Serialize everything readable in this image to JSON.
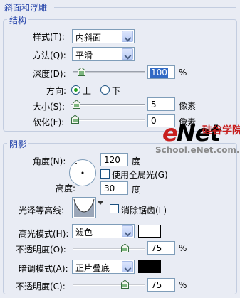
{
  "panel_title": "斜面和浮雕",
  "structure": {
    "title": "结构",
    "style_label": "样式(T):",
    "style_value": "内斜面",
    "technique_label": "方法(Q):",
    "technique_value": "平滑",
    "depth_label": "深度(D):",
    "depth_value": "100",
    "depth_unit": "%",
    "depth_slider_pct": 0.07,
    "direction_label": "方向:",
    "direction_up": "上",
    "direction_down": "下",
    "direction_selected": "up",
    "size_label": "大小(S):",
    "size_value": "5",
    "size_unit": "像素",
    "size_slider_pct": 0.02,
    "soften_label": "软化(F):",
    "soften_value": "0",
    "soften_unit": "像素",
    "soften_slider_pct": 0.0
  },
  "shading": {
    "title": "阴影",
    "angle_label": "角度(N):",
    "angle_value": "120",
    "angle_unit": "度",
    "global_light_label": "使用全局光(G)",
    "global_light_checked": false,
    "altitude_label": "高度:",
    "altitude_value": "30",
    "altitude_unit": "度",
    "gloss_contour_label": "光泽等高线:",
    "anti_alias_label": "消除锯齿(L)",
    "anti_alias_checked": false,
    "highlight_mode_label": "高光模式(H):",
    "highlight_mode_value": "滤色",
    "highlight_color": "#ffffff",
    "highlight_opacity_label": "不透明度(O):",
    "highlight_opacity_value": "75",
    "highlight_opacity_unit": "%",
    "highlight_opacity_pct": 0.75,
    "shadow_mode_label": "暗调模式(A):",
    "shadow_mode_value": "正片叠底",
    "shadow_color": "#000000",
    "shadow_opacity_label": "不透明度(C):",
    "shadow_opacity_value": "75",
    "shadow_opacity_unit": "%",
    "shadow_opacity_pct": 0.75
  },
  "watermark": {
    "brand_e": "e",
    "brand_net": "Net",
    "brand_cn": "硅谷学院",
    "site": "School.eNet.com.cn"
  }
}
